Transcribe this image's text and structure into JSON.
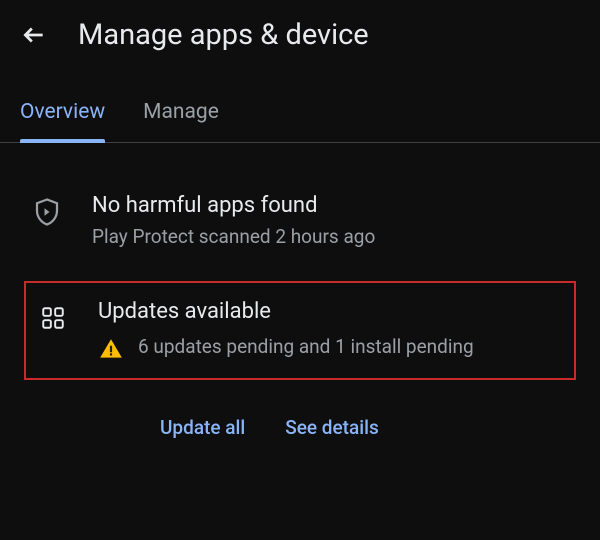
{
  "header": {
    "title": "Manage apps & device"
  },
  "tabs": {
    "overview": "Overview",
    "manage": "Manage"
  },
  "protect": {
    "title": "No harmful apps found",
    "subtitle": "Play Protect scanned 2 hours ago"
  },
  "updates": {
    "title": "Updates available",
    "subtitle": "6 updates pending and 1 install pending"
  },
  "actions": {
    "update_all": "Update all",
    "see_details": "See details"
  }
}
